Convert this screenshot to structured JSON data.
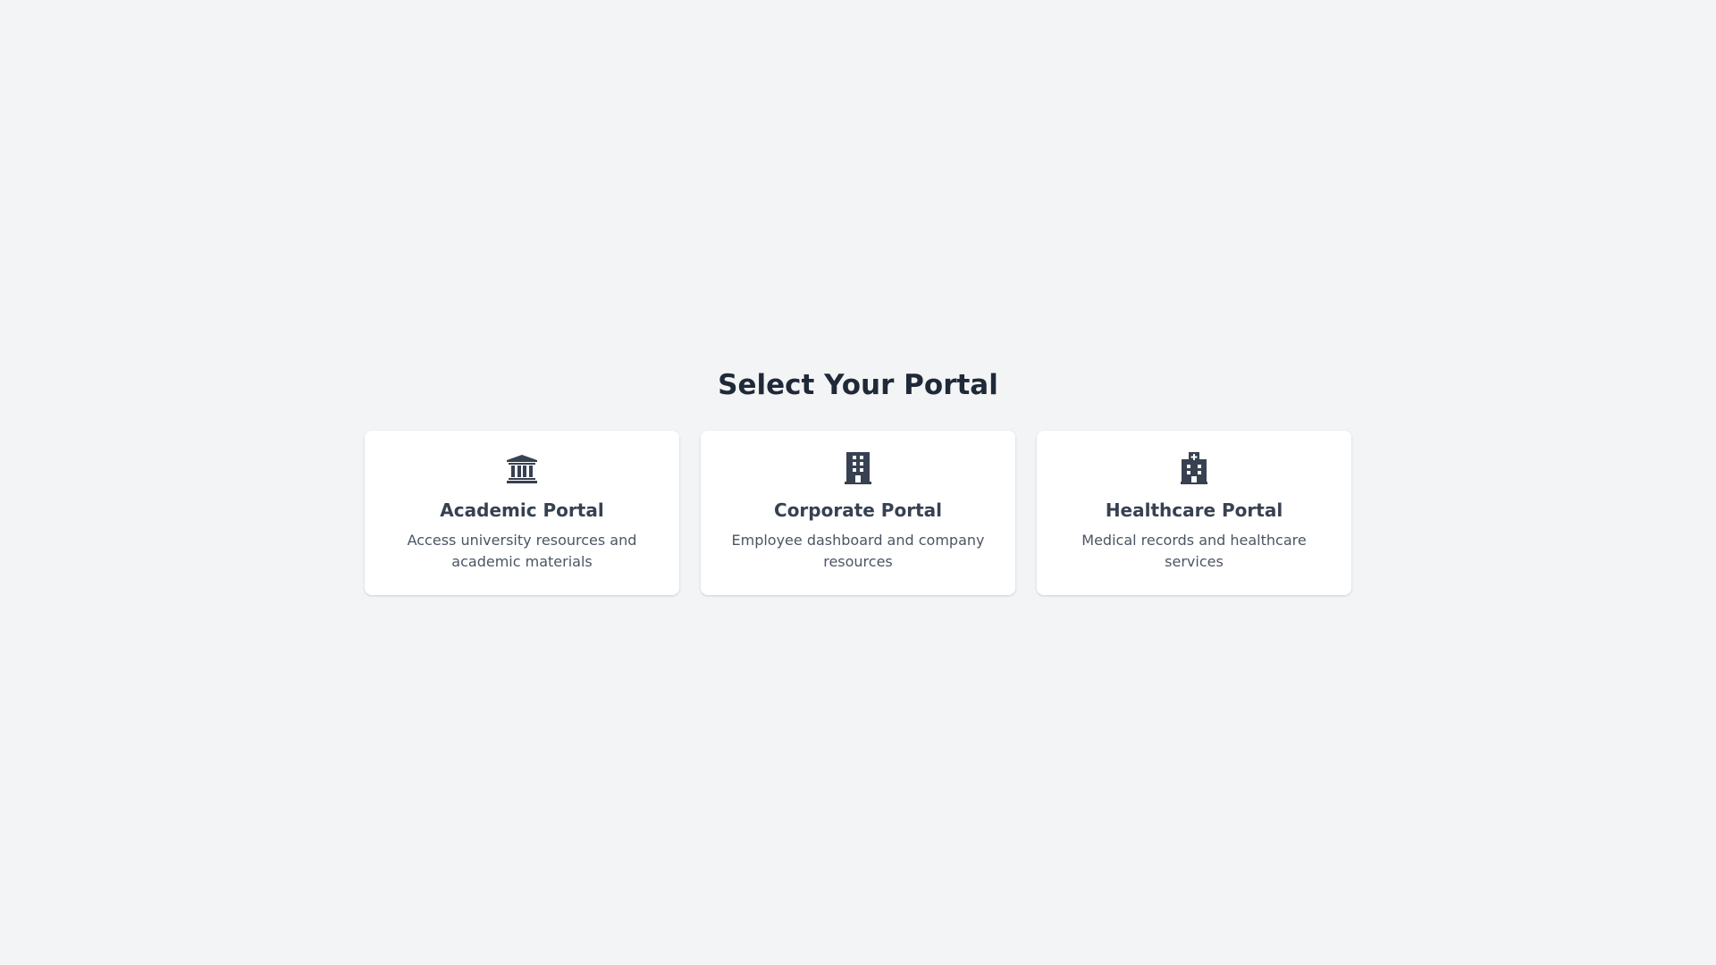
{
  "page": {
    "title": "Select Your Portal",
    "background_color": "#f3f4f6"
  },
  "portals": [
    {
      "icon": "university-icon",
      "title": "Academic Portal",
      "description": "Access university resources and academic materials"
    },
    {
      "icon": "building-icon",
      "title": "Corporate Portal",
      "description": "Employee dashboard and company resources"
    },
    {
      "icon": "hospital-icon",
      "title": "Healthcare Portal",
      "description": "Medical records and healthcare services"
    }
  ],
  "colors": {
    "card_background": "#ffffff",
    "icon": "#374151",
    "heading": "#1f2937",
    "description": "#4b5563"
  }
}
